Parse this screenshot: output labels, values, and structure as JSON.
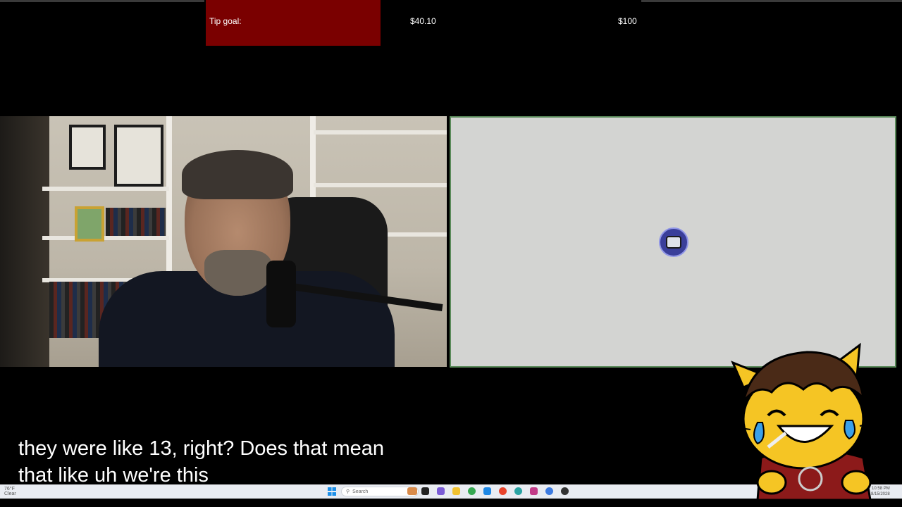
{
  "tip_goal": {
    "label": "Tip goal:",
    "current": "$40.10",
    "target": "$100",
    "progress_fraction": 0.401,
    "fill_color": "#7a0000"
  },
  "screen_share": {
    "background_color": "#d3d4d2",
    "center_icon": "loading-app-icon"
  },
  "captions": {
    "line1": "they were like 13, right? Does that mean",
    "line2": "that like uh we're this"
  },
  "taskbar": {
    "weather_temp": "76°F",
    "weather_desc": "Clear",
    "search_label": "Search",
    "time": "10:58 PM",
    "date": "8/15/2028"
  },
  "avatar": {
    "description_icon": "cat-mascot-laughing-icon",
    "colors": {
      "fur": "#f5c524",
      "hair": "#4a2a17",
      "shirt": "#8c1a1a"
    }
  }
}
